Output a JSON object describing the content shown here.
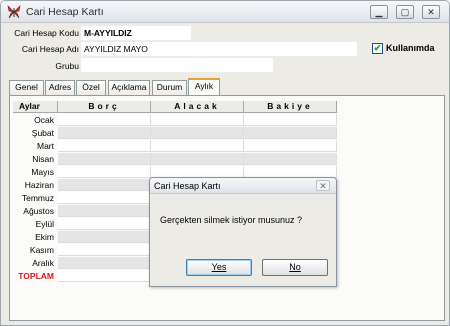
{
  "window": {
    "title": "Cari Hesap Kartı",
    "icon": "butterfly-app-icon",
    "controls": [
      "minimize",
      "maximize",
      "close"
    ]
  },
  "form": {
    "code_label": "Cari Hesap Kodu",
    "code_value": "M-AYYILDIZ",
    "name_label": "Cari Hesap Adı",
    "name_value": "AYYILDIZ MAYO",
    "group_label": "Grubu",
    "group_value": "",
    "active_label": "Kullanımda",
    "active_checked": true
  },
  "tabs": [
    "Genel",
    "Adres",
    "Özel",
    "Açıklama",
    "Durum",
    "Aylık"
  ],
  "active_tab": "Aylık",
  "grid": {
    "columns": [
      "Aylar",
      "Borç",
      "Alacak",
      "Bakiye"
    ],
    "months": [
      "Ocak",
      "Şubat",
      "Mart",
      "Nisan",
      "Mayıs",
      "Haziran",
      "Temmuz",
      "Ağustos",
      "Eylül",
      "Ekim",
      "Kasım",
      "Aralık"
    ],
    "total_label": "TOPLAM"
  },
  "dialog": {
    "title": "Cari Hesap Kartı",
    "message": "Gerçekten silmek istiyor musunuz ?",
    "yes_label": "Yes",
    "no_label": "No"
  },
  "colors": {
    "total_text": "#d71e1e",
    "tab_highlight": "#e6a23a",
    "checkbox_tick": "#21a121"
  }
}
